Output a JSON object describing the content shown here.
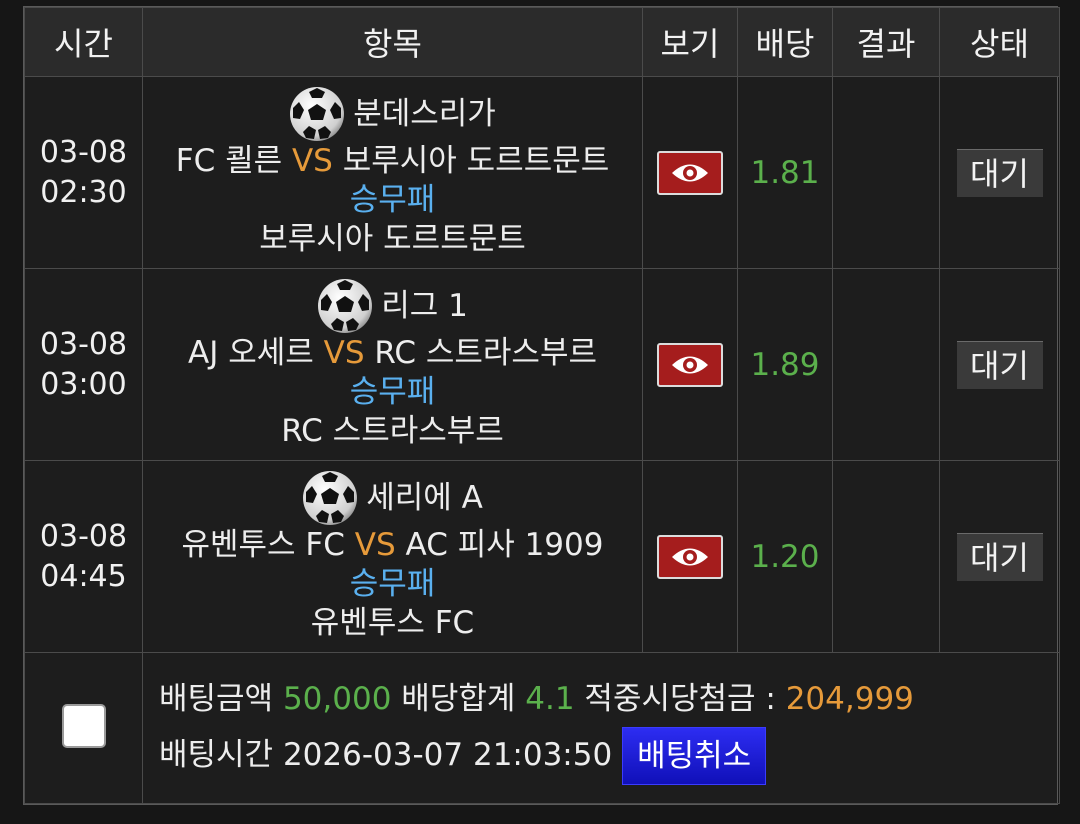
{
  "headers": {
    "time": "시간",
    "item": "항목",
    "view": "보기",
    "odds": "배당",
    "result": "결과",
    "status": "상태"
  },
  "rows": [
    {
      "date": "03-08",
      "time": "02:30",
      "league": "분데스리가",
      "home": "FC 쾰른",
      "vs": "VS",
      "away": "보루시아 도르트문트",
      "market": "승무패",
      "pick": "보루시아 도르트문트",
      "odds": "1.81",
      "result": "",
      "status": "대기"
    },
    {
      "date": "03-08",
      "time": "03:00",
      "league": "리그 1",
      "home": "AJ 오세르",
      "vs": "VS",
      "away": "RC 스트라스부르",
      "market": "승무패",
      "pick": "RC 스트라스부르",
      "odds": "1.89",
      "result": "",
      "status": "대기"
    },
    {
      "date": "03-08",
      "time": "04:45",
      "league": "세리에 A",
      "home": "유벤투스 FC",
      "vs": "VS",
      "away": "AC 피사 1909",
      "market": "승무패",
      "pick": "유벤투스 FC",
      "odds": "1.20",
      "result": "",
      "status": "대기"
    }
  ],
  "summary": {
    "amount_label": "배팅금액",
    "amount": "50,000",
    "total_odds_label": "배당합계",
    "total_odds": "4.1",
    "payout_label": "적중시당첨금 :",
    "payout": "204,999",
    "bet_time_label": "배팅시간",
    "bet_time": "2026-03-07 21:03:50",
    "cancel_label": "배팅취소"
  },
  "colors": {
    "vs": "#e69a3a",
    "market": "#5ab0ef",
    "odds": "#5bb04c",
    "view_button": "#a51d1d",
    "cancel_button": "#1a1ad6"
  },
  "icons": {
    "league": "soccer-ball-icon",
    "view": "eye-icon"
  }
}
